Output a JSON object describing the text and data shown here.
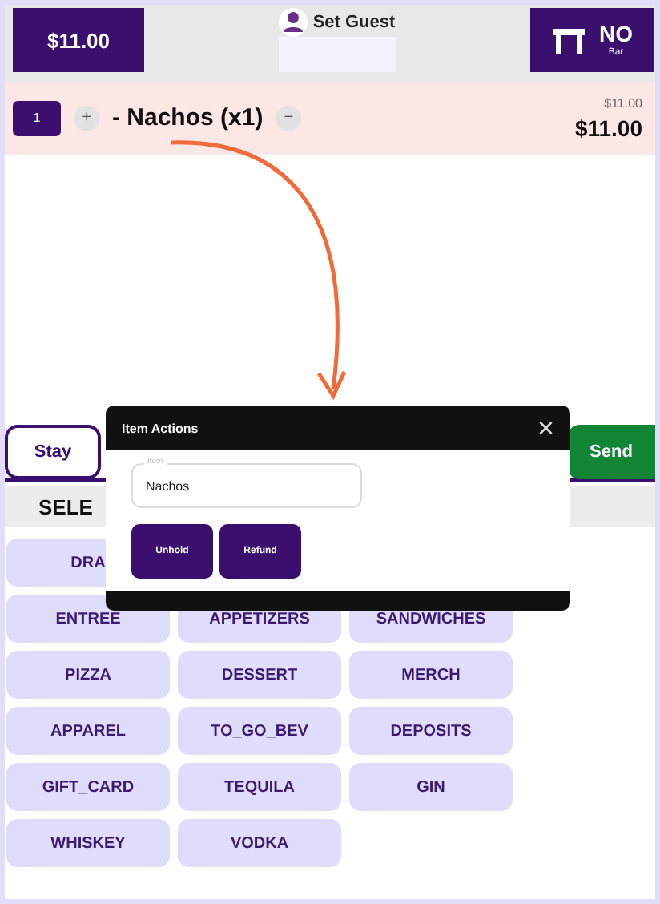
{
  "header": {
    "total": "$11.00",
    "guest": "Set Guest",
    "table": {
      "label": "NO",
      "sublabel": "Bar"
    }
  },
  "order_items": [
    {
      "qty": "1",
      "plus": "+",
      "name": "- Nachos (x1)",
      "minus": "−",
      "unit_price": "$11.00",
      "price": "$11.00"
    }
  ],
  "order_types": [
    {
      "label": "Stay"
    }
  ],
  "send": "Send",
  "section_title": "SELE",
  "category_rows": [
    [
      "DRA"
    ],
    [
      "ENTREE",
      "APPETIZERS",
      "SANDWICHES"
    ],
    [
      "PIZZA",
      "DESSERT",
      "MERCH"
    ],
    [
      "APPAREL",
      "TO_GO_BEV",
      "DEPOSITS"
    ],
    [
      "GIFT_CARD",
      "TEQUILA",
      "GIN"
    ],
    [
      "WHISKEY",
      "VODKA"
    ]
  ],
  "modal": {
    "title": "Item Actions",
    "close": "×",
    "field": {
      "label": "Item",
      "value": "Nachos"
    },
    "buttons": [
      "Unhold",
      "Refund"
    ]
  }
}
